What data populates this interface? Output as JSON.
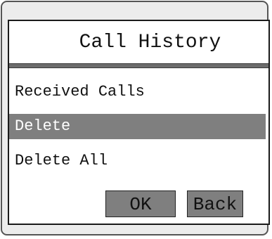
{
  "screen": {
    "title": "Call History"
  },
  "menu": {
    "items": [
      {
        "label": "Received Calls",
        "selected": false
      },
      {
        "label": "Delete",
        "selected": true
      },
      {
        "label": "Delete All",
        "selected": false
      }
    ]
  },
  "softkeys": {
    "ok_label": "OK",
    "back_label": "Back"
  },
  "colors": {
    "highlight": "#7f7f7f",
    "divider": "#6c6c6c",
    "frame": "#ececec"
  }
}
